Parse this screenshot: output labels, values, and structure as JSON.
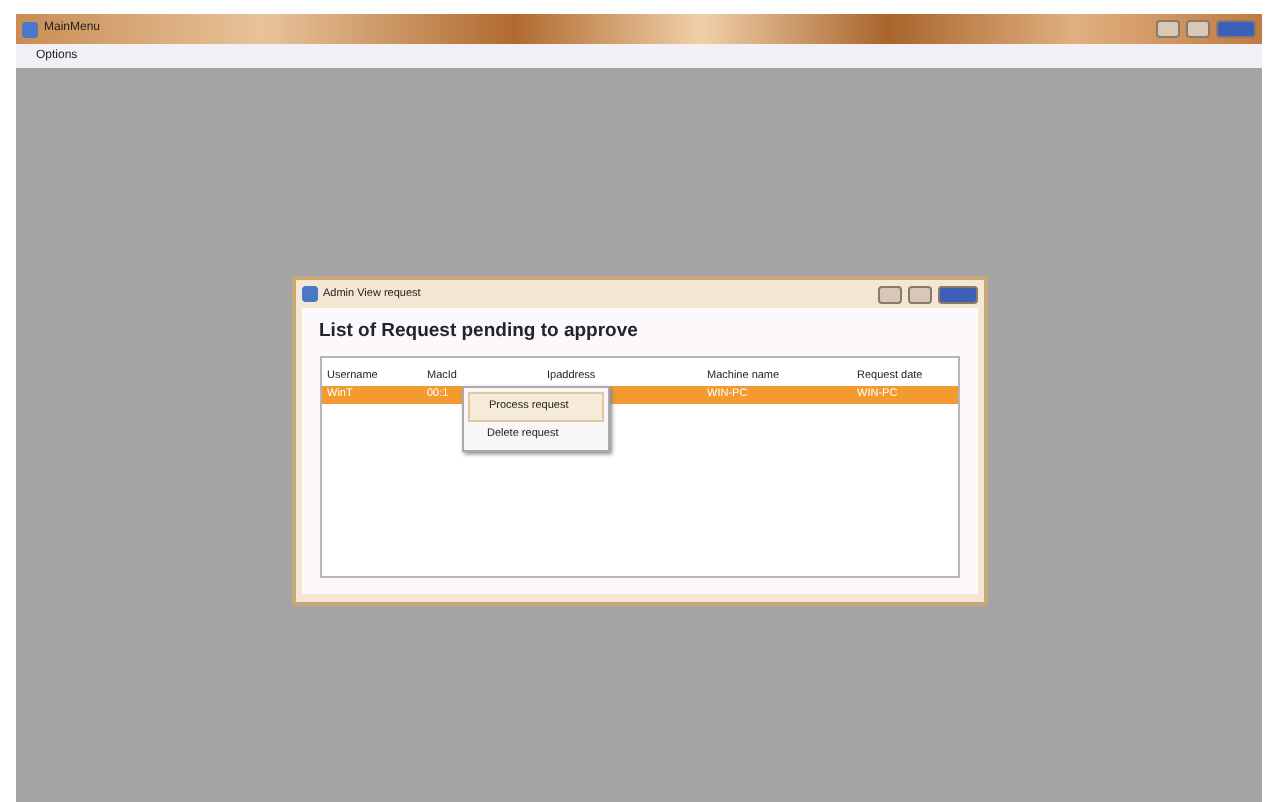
{
  "window": {
    "title": "MainMenu"
  },
  "menu": [
    {
      "label": "Options"
    }
  ],
  "dialog": {
    "title": "Admin View request",
    "heading": "List of Request pending to approve",
    "table": {
      "columns": [
        "Username",
        "MacId",
        "Ipaddress",
        "Machine name",
        "Request date"
      ],
      "rows": [
        {
          "cells": [
            "WinT",
            "00:1",
            "",
            "WIN-PC",
            "WIN-PC"
          ],
          "selected": true
        }
      ]
    },
    "context_menu": [
      {
        "label": "Process request",
        "selected": true
      },
      {
        "label": "Delete request",
        "selected": false
      }
    ]
  }
}
